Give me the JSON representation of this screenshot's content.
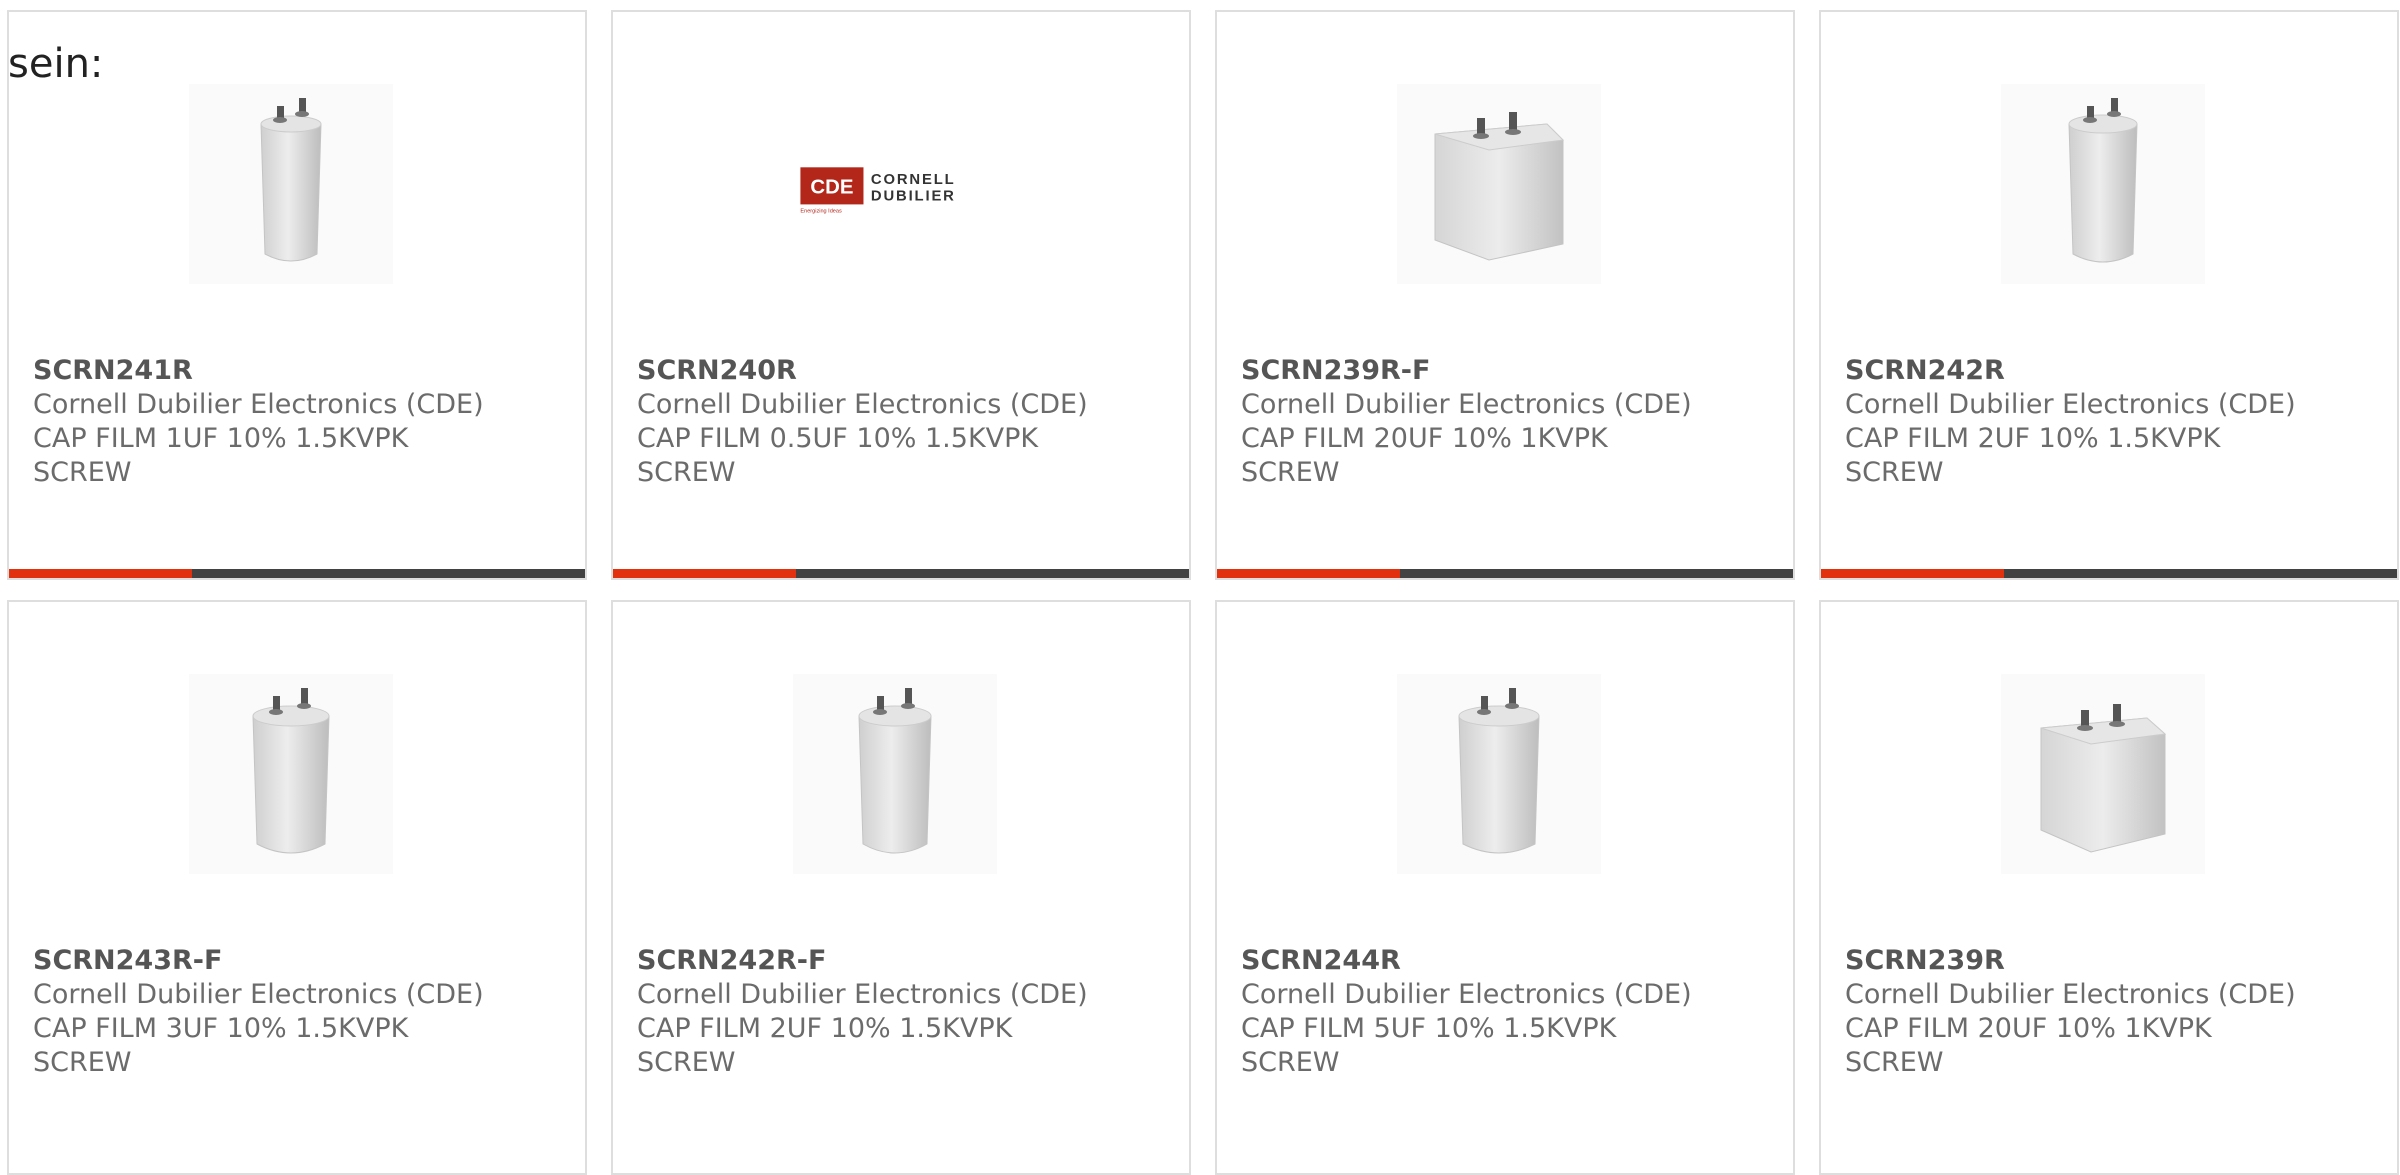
{
  "page": {
    "stray_text": "sein:"
  },
  "theme": {
    "accent_color": "#e2310f",
    "bar_color": "#424242",
    "border_color": "#dedede"
  },
  "products": [
    {
      "part_number": "SCRN241R",
      "manufacturer": "Cornell Dubilier Electronics (CDE)",
      "description": "CAP FILM 1UF 10% 1.5KVPK SCREW",
      "image": "oval-capacitor-image"
    },
    {
      "part_number": "SCRN240R",
      "manufacturer": "Cornell Dubilier Electronics (CDE)",
      "description": "CAP FILM 0.5UF 10% 1.5KVPK SCREW",
      "image": "cde-logo",
      "logo": {
        "mark": "CDE",
        "line1": "CORNELL",
        "line2": "DUBILIER",
        "tagline": "Energizing Ideas"
      }
    },
    {
      "part_number": "SCRN239R-F",
      "manufacturer": "Cornell Dubilier Electronics (CDE)",
      "description": "CAP FILM 20UF 10% 1KVPK SCREW",
      "image": "box-capacitor-image"
    },
    {
      "part_number": "SCRN242R",
      "manufacturer": "Cornell Dubilier Electronics (CDE)",
      "description": "CAP FILM 2UF 10% 1.5KVPK SCREW",
      "image": "oval-capacitor-image"
    },
    {
      "part_number": "SCRN243R-F",
      "manufacturer": "Cornell Dubilier Electronics (CDE)",
      "description": "CAP FILM 3UF 10% 1.5KVPK SCREW",
      "image": "oval-capacitor-image"
    },
    {
      "part_number": "SCRN242R-F",
      "manufacturer": "Cornell Dubilier Electronics (CDE)",
      "description": "CAP FILM 2UF 10% 1.5KVPK SCREW",
      "image": "oval-capacitor-image"
    },
    {
      "part_number": "SCRN244R",
      "manufacturer": "Cornell Dubilier Electronics (CDE)",
      "description": "CAP FILM 5UF 10% 1.5KVPK SCREW",
      "image": "oval-capacitor-image"
    },
    {
      "part_number": "SCRN239R",
      "manufacturer": "Cornell Dubilier Electronics (CDE)",
      "description": "CAP FILM 20UF 10% 1KVPK SCREW",
      "image": "box-capacitor-image"
    }
  ]
}
